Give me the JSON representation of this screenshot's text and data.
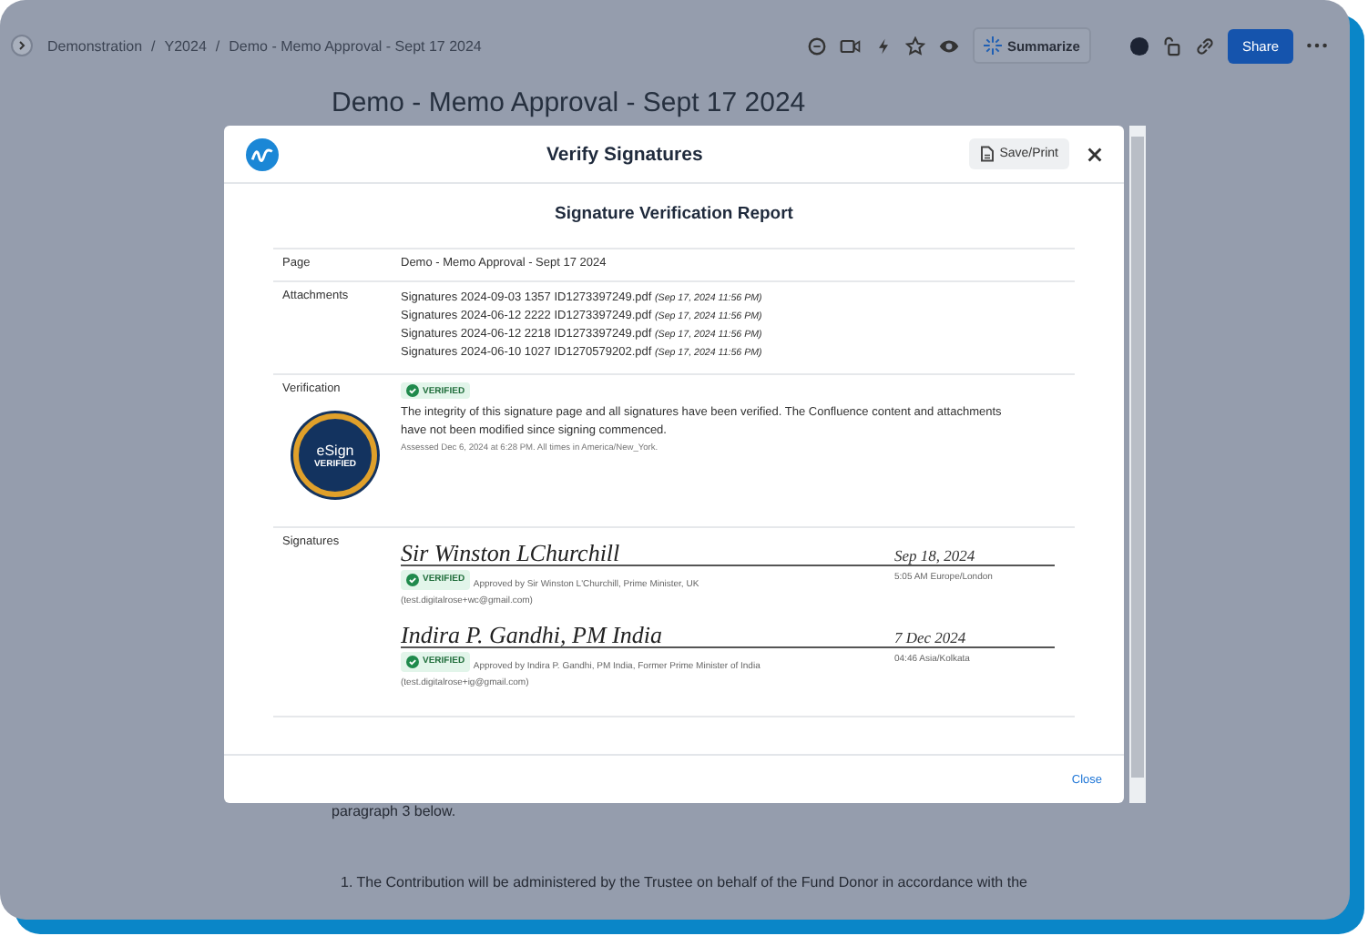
{
  "breadcrumbs": [
    "Demonstration",
    "Y2024",
    "Demo - Memo Approval - Sept 17 2024"
  ],
  "breadcrumb_separator": "/",
  "toolbar": {
    "summarize": "Summarize",
    "share": "Share"
  },
  "page": {
    "title": "Demo - Memo Approval - Sept 17 2024",
    "paragraphs": [
      "paragraph 3 below.",
      "1. The Contribution will be administered by the Trustee on behalf of the Fund Donor in accordance with the"
    ]
  },
  "dialog": {
    "title": "Verify Signatures",
    "save_print": "Save/Print",
    "close_button": "Close",
    "report": {
      "title": "Signature Verification Report",
      "page_label": "Page",
      "page_value": "Demo - Memo Approval - Sept 17 2024",
      "attachments_label": "Attachments",
      "attachments": [
        {
          "name": "Signatures 2024-09-03 1357 ID1273397249.pdf",
          "date": "(Sep 17, 2024 11:56 PM)"
        },
        {
          "name": "Signatures 2024-06-12 2222 ID1273397249.pdf",
          "date": "(Sep 17, 2024 11:56 PM)"
        },
        {
          "name": "Signatures 2024-06-12 2218 ID1273397249.pdf",
          "date": "(Sep 17, 2024 11:56 PM)"
        },
        {
          "name": "Signatures 2024-06-10 1027 ID1270579202.pdf",
          "date": "(Sep 17, 2024 11:56 PM)"
        }
      ],
      "verification_label": "Verification",
      "status": "VERIFIED",
      "seal": {
        "top": "eSign",
        "bottom": "VERIFIED"
      },
      "message": "The integrity of this signature page and all signatures have been verified. The Confluence content and attachments have not been modified since signing commenced.",
      "assessed": "Assessed Dec 6, 2024 at 6:28 PM. All times in America/New_York.",
      "signatures_label": "Signatures",
      "signatures": [
        {
          "signature": "Sir Winston LChurchill",
          "date": "Sep 18, 2024",
          "status": "VERIFIED",
          "approved_by": "Approved by Sir Winston L'Churchill, Prime Minister, UK",
          "email": "(test.digitalrose+wc@gmail.com)",
          "time": "5:05 AM Europe/London"
        },
        {
          "signature": "Indira P. Gandhi, PM India",
          "date": "7 Dec 2024",
          "status": "VERIFIED",
          "approved_by": "Approved by Indira P. Gandhi, PM India, Former Prime Minister of India",
          "email": "(test.digitalrose+ig@gmail.com)",
          "time": "04:46 Asia/Kolkata"
        }
      ]
    }
  }
}
